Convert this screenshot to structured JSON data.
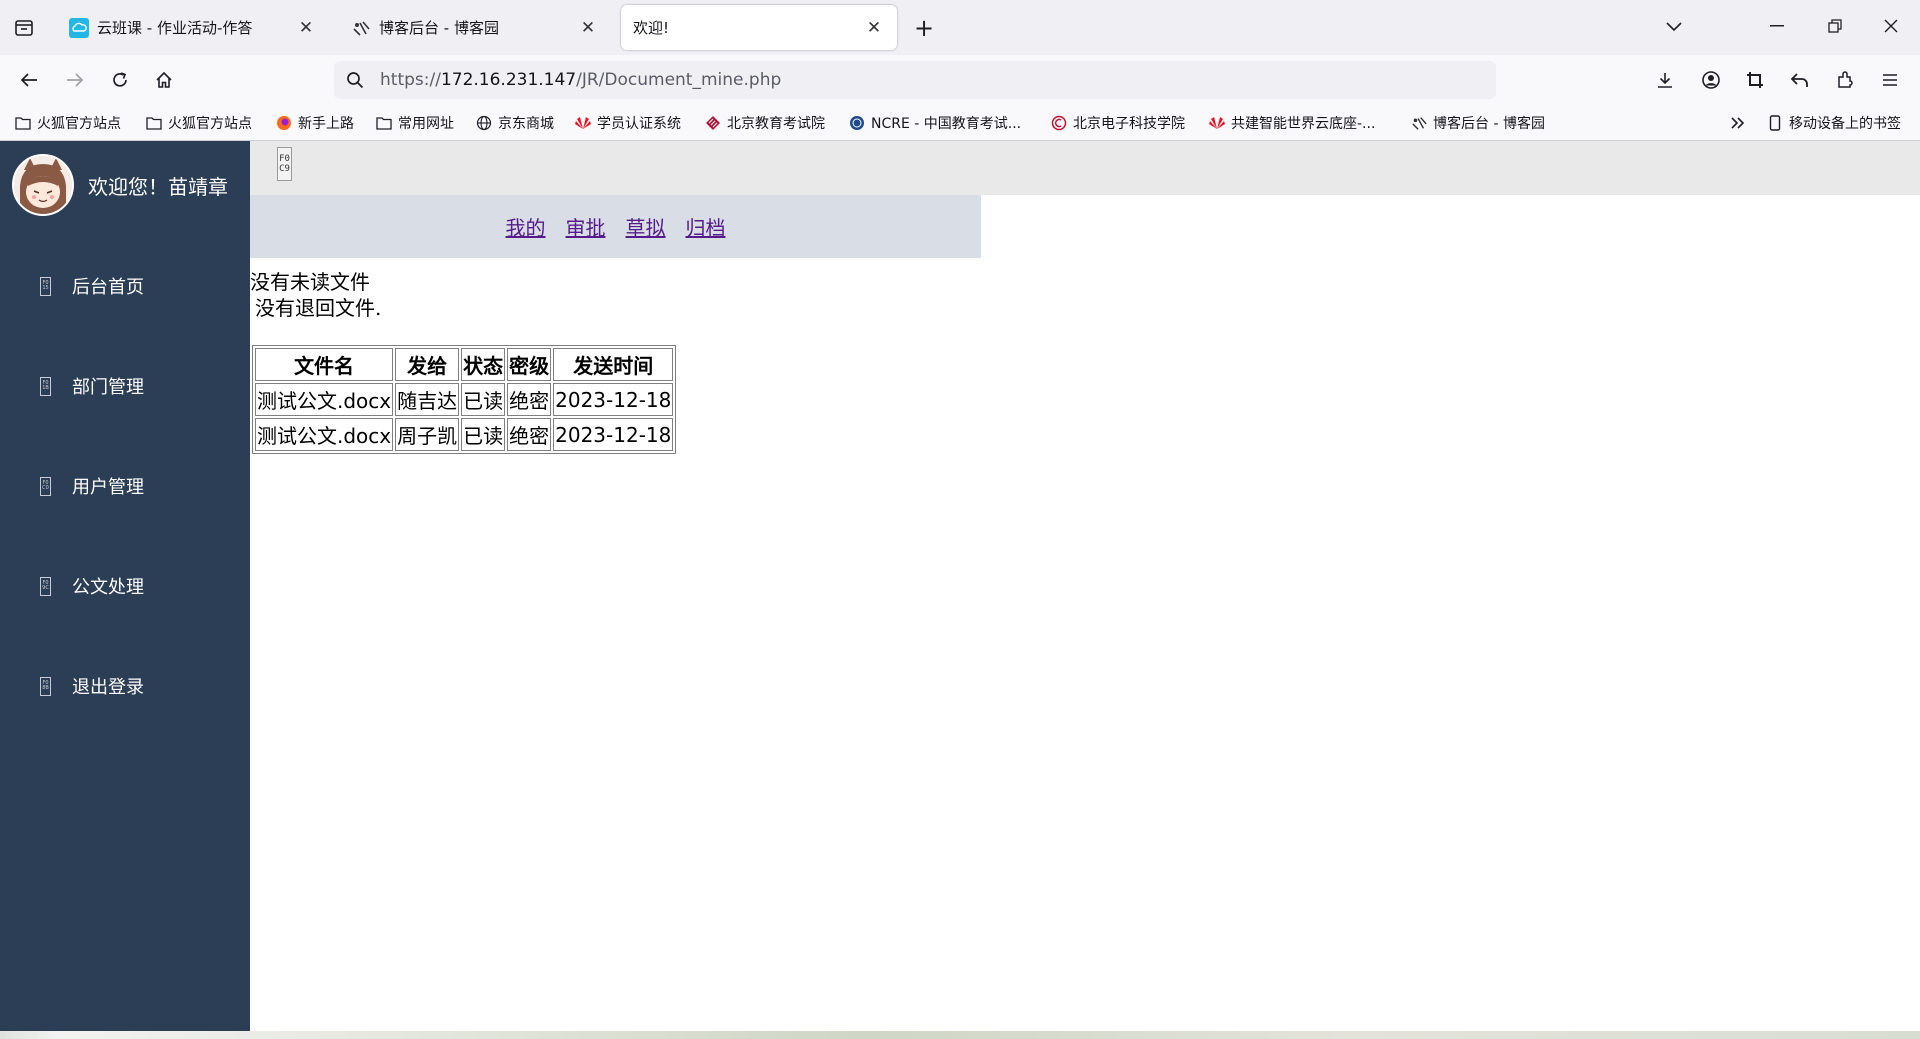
{
  "browser": {
    "tabs": [
      {
        "title": "云班课 - 作业活动-作答",
        "active": false
      },
      {
        "title": "博客后台 - 博客园",
        "active": false
      },
      {
        "title": "欢迎!",
        "active": true
      }
    ],
    "url": {
      "protocol": "https://",
      "host": "172.16.231.147",
      "path": "/JR/Document_mine.php"
    },
    "bookmarks": [
      {
        "label": "火狐官方站点",
        "icon": "folder-icon"
      },
      {
        "label": "火狐官方站点",
        "icon": "folder-icon"
      },
      {
        "label": "新手上路",
        "icon": "firefox-icon"
      },
      {
        "label": "常用网址",
        "icon": "folder-icon"
      },
      {
        "label": "京东商城",
        "icon": "globe-icon"
      },
      {
        "label": "学员认证系统",
        "icon": "huawei-icon"
      },
      {
        "label": "北京教育考试院",
        "icon": "bjeea-icon"
      },
      {
        "label": "NCRE - 中国教育考试...",
        "icon": "ncre-icon"
      },
      {
        "label": "北京电子科技学院",
        "icon": "besti-icon"
      },
      {
        "label": "共建智能世界云底座-...",
        "icon": "huawei-icon"
      },
      {
        "label": "博客后台 - 博客园",
        "icon": "cnblogs-icon"
      }
    ],
    "mobile_bookmarks": "移动设备上的书签",
    "colors": {
      "tabstrip": "#f0f0f4",
      "toolbar": "#f9f9fb"
    }
  },
  "sidebar": {
    "welcome": "欢迎您！苗靖章",
    "items": [
      {
        "label": "后台首页",
        "icon_text": "F0 15"
      },
      {
        "label": "部门管理",
        "icon_text": "F0 1B"
      },
      {
        "label": "用户管理",
        "icon_text": "F0 C0"
      },
      {
        "label": "公文处理",
        "icon_text": "F0 9C"
      },
      {
        "label": "退出登录",
        "icon_text": "F0 8B"
      }
    ],
    "color": "#2c3e55"
  },
  "content": {
    "broken_image_text": "F0 C9",
    "subnav": [
      "我的",
      "审批",
      "草拟",
      "归档"
    ],
    "unread_msg": "没有未读文件",
    "returned_msg": "没有退回文件.",
    "table": {
      "headers": [
        "文件名",
        "发给",
        "状态",
        "密级",
        "发送时间"
      ],
      "rows": [
        [
          "测试公文.docx",
          "随吉达",
          "已读",
          "绝密",
          "2023-12-18"
        ],
        [
          "测试公文.docx",
          "周子凯",
          "已读",
          "绝密",
          "2023-12-18"
        ]
      ]
    }
  }
}
